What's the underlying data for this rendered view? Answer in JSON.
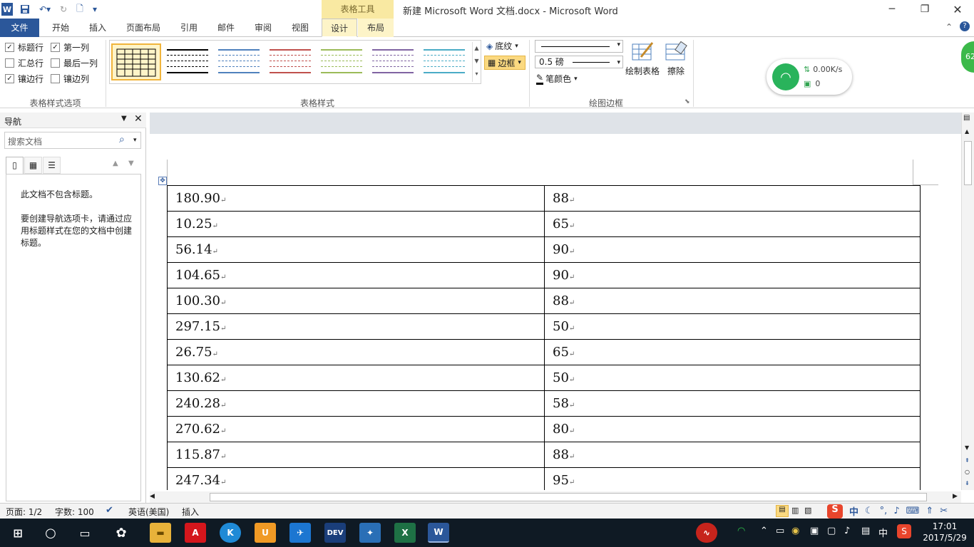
{
  "window": {
    "title": "新建 Microsoft Word 文档.docx  -  Microsoft Word",
    "context_tab_header": "表格工具"
  },
  "tabs": [
    "文件",
    "开始",
    "插入",
    "页面布局",
    "引用",
    "邮件",
    "审阅",
    "视图",
    "设计",
    "布局"
  ],
  "ribbon": {
    "style_options": {
      "label": "表格样式选项",
      "items": [
        {
          "label": "标题行",
          "checked": true
        },
        {
          "label": "第一列",
          "checked": true
        },
        {
          "label": "汇总行",
          "checked": false
        },
        {
          "label": "最后一列",
          "checked": false
        },
        {
          "label": "镶边行",
          "checked": true
        },
        {
          "label": "镶边列",
          "checked": false
        }
      ]
    },
    "table_styles": {
      "label": "表格样式",
      "colors": [
        "#000000",
        "#000000",
        "#4f81bd",
        "#c0504d",
        "#9bbb59",
        "#8064a2",
        "#4bacc6"
      ]
    },
    "shading_label": "底纹",
    "borders_label": "边框",
    "draw_borders": {
      "label": "绘图边框",
      "pen_weight": "0.5 磅",
      "pen_color_label": "笔颜色",
      "draw_table_label": "绘制表格",
      "eraser_label": "擦除"
    }
  },
  "net_widget": {
    "speed": "0.00K/s",
    "count": "0",
    "badge": "62"
  },
  "nav": {
    "title": "导航",
    "search_placeholder": "搜索文档",
    "no_headings": "此文档不包含标题。",
    "hint": "要创建导航选项卡，请通过应用标题样式在您的文档中创建标题。"
  },
  "table": {
    "rows": [
      [
        "180.90",
        "88"
      ],
      [
        "10.25",
        "65"
      ],
      [
        "56.14",
        "90"
      ],
      [
        "104.65",
        "90"
      ],
      [
        "100.30",
        "88"
      ],
      [
        "297.15",
        "50"
      ],
      [
        "26.75",
        "65"
      ],
      [
        "130.62",
        "50"
      ],
      [
        "240.28",
        "58"
      ],
      [
        "270.62",
        "80"
      ],
      [
        "115.87",
        "88"
      ],
      [
        "247.34",
        "95"
      ]
    ]
  },
  "status": {
    "page": "页面: 1/2",
    "words": "字数: 100",
    "language": "英语(美国)",
    "mode": "插入"
  },
  "ime": {
    "lang": "中"
  },
  "clock": {
    "time": "17:01",
    "date": "2017/5/29"
  },
  "taskbar_tray_lang": "中"
}
